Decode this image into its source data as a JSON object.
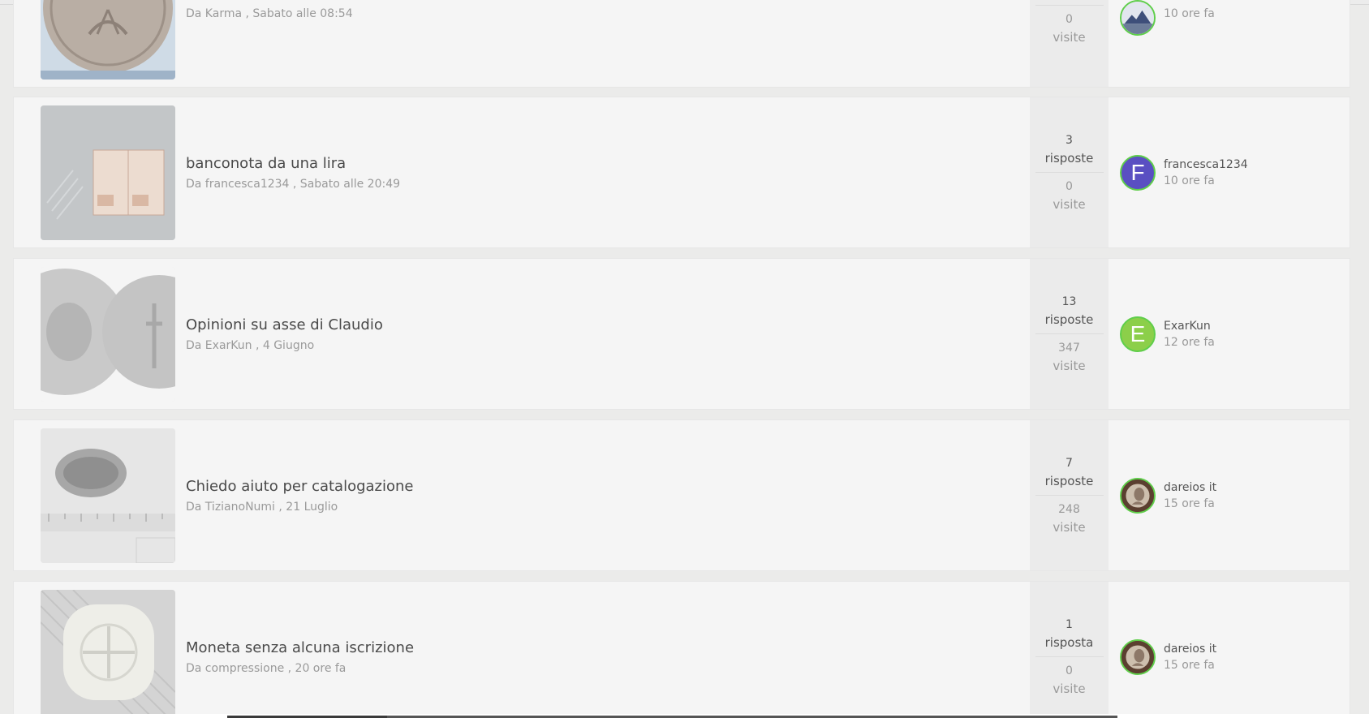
{
  "colors": {
    "accent": "#1fa1e0",
    "row_bg": "#f5f5f5",
    "stats_bg": "#ebebeb",
    "avatar_ring": "#5fce4a",
    "avatar_f": "#5a4fc2",
    "avatar_e": "#8ccf4a"
  },
  "topics": [
    {
      "title": "",
      "meta": "Da Karma , Sabato alle 08:54",
      "views_num": "0",
      "views_label": "visite",
      "last_time": "10 ore fa",
      "thumb_icon": "coin-photo-icon",
      "avatar_icon": "landscape-avatar-icon"
    },
    {
      "title": "banconota da una lira",
      "meta": "Da francesca1234 , Sabato alle 20:49",
      "replies_num": "3",
      "replies_label": "risposte",
      "views_num": "0",
      "views_label": "visite",
      "last_user": "francesca1234",
      "last_time": "10 ore fa",
      "avatar_letter": "F",
      "thumb_icon": "banknote-photo-icon"
    },
    {
      "title": "Opinioni su asse di Claudio",
      "meta": "Da ExarKun , 4 Giugno",
      "replies_num": "13",
      "replies_label": "risposte",
      "views_num": "347",
      "views_label": "visite",
      "last_user": "ExarKun",
      "last_time": "12 ore fa",
      "avatar_letter": "E",
      "thumb_icon": "roman-coin-photo-icon"
    },
    {
      "title": "Chiedo aiuto per catalogazione",
      "meta": "Da TizianoNumi , 21 Luglio",
      "replies_num": "7",
      "replies_label": "risposte",
      "views_num": "248",
      "views_label": "visite",
      "last_user": "dareios it",
      "last_time": "15 ore fa",
      "thumb_icon": "coin-with-ruler-photo-icon",
      "avatar_icon": "portrait-avatar-icon"
    },
    {
      "title": "Moneta senza alcuna iscrizione",
      "meta": "Da compressione , 20 ore fa",
      "replies_num": "1",
      "replies_label": "risposta",
      "views_num": "0",
      "views_label": "visite",
      "last_user": "dareios it",
      "last_time": "15 ore fa",
      "thumb_icon": "square-coin-photo-icon",
      "avatar_icon": "portrait-avatar-icon"
    }
  ]
}
